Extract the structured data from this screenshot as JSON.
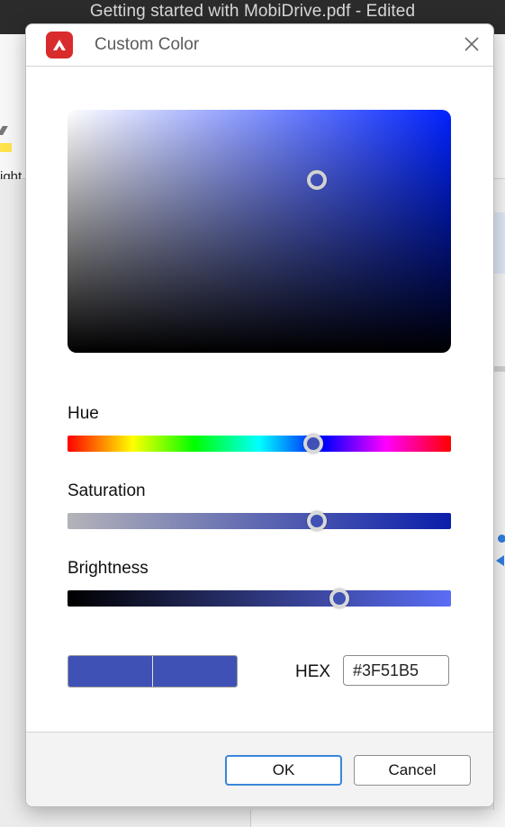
{
  "window": {
    "title": "Getting started with MobiDrive.pdf - Edited"
  },
  "toolbar": {
    "highlight_label_partial": "ight"
  },
  "dialog": {
    "title": "Custom Color",
    "hue": {
      "label": "Hue",
      "value": 0.64
    },
    "saturation": {
      "label": "Saturation",
      "value": 0.65
    },
    "brightness": {
      "label": "Brightness",
      "value": 0.71
    },
    "picker": {
      "saturation_value": 0.65,
      "brightness_value": 0.71
    },
    "swatch": {
      "old_color": "#3F51B5",
      "new_color": "#3F51B5"
    },
    "hex": {
      "label": "HEX",
      "value": "#3F51B5"
    },
    "ok_label": "OK",
    "cancel_label": "Cancel"
  },
  "colors": {
    "accent": "#3a86d8",
    "brand": "#d92b2b",
    "selected": "#3F51B5"
  },
  "icons": {
    "logo": "mobidrive-logo-icon",
    "close": "close-icon"
  }
}
